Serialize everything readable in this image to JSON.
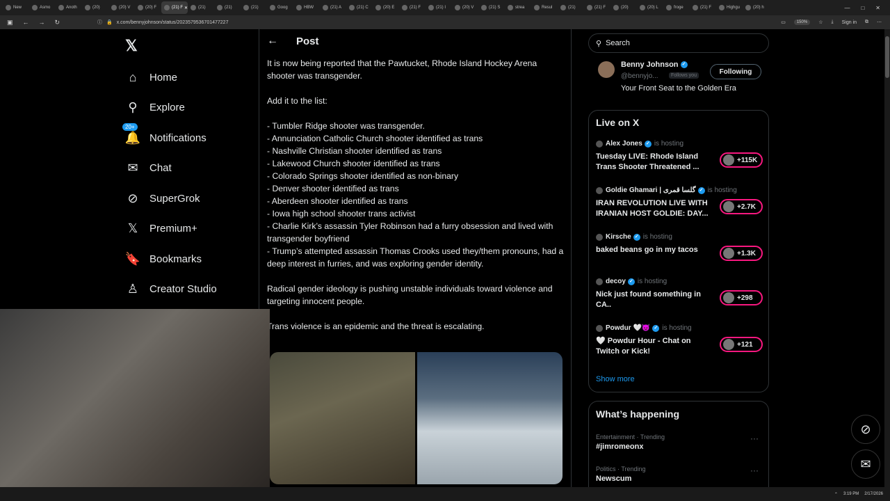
{
  "browser": {
    "tabs": [
      "New",
      "Asmo",
      "Anoth",
      "(20) ",
      "(20) V",
      "(20) F",
      "(21) F",
      "(21) ",
      "(21) ",
      "(21) ",
      "Goog",
      "HBW",
      "(21) A",
      "(21) C",
      "(20) E",
      "(21) F",
      "(21) I",
      "(20) V",
      "(21) S",
      "strea",
      "Resul",
      "(21) ",
      "(21) F",
      "(20) ",
      "(20) L",
      "froge",
      "(21) F",
      "Highgu",
      "(20) h"
    ],
    "active_tab_index": 6,
    "url": "x.com/bennyjohnson/status/2023579536701477227",
    "zoom": "150%",
    "sign_in": "Sign in",
    "clock_time": "3:19 PM",
    "clock_date": "2/17/2026"
  },
  "nav": {
    "home": "Home",
    "explore": "Explore",
    "notifications": "Notifications",
    "notifications_badge": "20+",
    "chat": "Chat",
    "supergrok": "SuperGrok",
    "premium": "Premium+",
    "bookmarks": "Bookmarks",
    "creator_studio": "Creator Studio"
  },
  "post": {
    "header": "Post",
    "lines": [
      "It is now being reported that the Pawtucket, Rhode Island Hockey Arena shooter was transgender.",
      "",
      "Add it to the list:",
      "",
      "- Tumbler Ridge shooter was transgender.",
      "- Annunciation Catholic Church shooter identified as trans",
      "- Nashville Christian shooter identified as trans",
      "- Lakewood Church shooter identified as trans",
      "- Colorado Springs shooter identified as non-binary",
      "- Denver shooter identified as trans",
      "- Aberdeen shooter identified as trans",
      "- Iowa high school shooter trans activist",
      "- Charlie Kirk’s assassin Tyler Robinson had a furry obsession and lived with transgender boyfriend",
      "- Trump’s attempted assassin Thomas Crooks used they/them pronouns, had a deep interest in furries, and was exploring gender identity.",
      "",
      "Radical gender ideology is pushing unstable individuals toward violence and targeting innocent people.",
      "",
      "Trans violence is an epidemic and the threat is escalating."
    ]
  },
  "search": {
    "placeholder": "Search"
  },
  "profile": {
    "name": "Benny Johnson",
    "handle": "@bennyjo...",
    "follows_you": "Follows you",
    "bio": "Your Front Seat to the Golden Era",
    "follow_label": "Following"
  },
  "live": {
    "title": "Live on X",
    "hosting_label": "is hosting",
    "items": [
      {
        "host": "Alex Jones",
        "title": "Tuesday LIVE: Rhode Island Trans Shooter Threatened ...",
        "count": "+115K"
      },
      {
        "host": "Goldie Ghamari | گلسا قمری",
        "title": "IRAN REVOLUTION LIVE WITH IRANIAN HOST GOLDIE: DAY...",
        "count": "+2.7K"
      },
      {
        "host": "Kirsche",
        "title": "baked beans go in my tacos",
        "count": "+1.3K"
      },
      {
        "host": "decoy",
        "title": "Nick just found something in CA..",
        "count": "+298"
      },
      {
        "host": "Powdur 🤍😈",
        "title": "🤍 Powdur Hour - Chat on Twitch or  Kick!",
        "count": "+121"
      }
    ],
    "show_more": "Show more"
  },
  "happening": {
    "title": "What’s happening",
    "trends": [
      {
        "category": "Entertainment · Trending",
        "name": "#jimromeonx"
      },
      {
        "category": "Politics · Trending",
        "name": "Newscum"
      }
    ]
  }
}
